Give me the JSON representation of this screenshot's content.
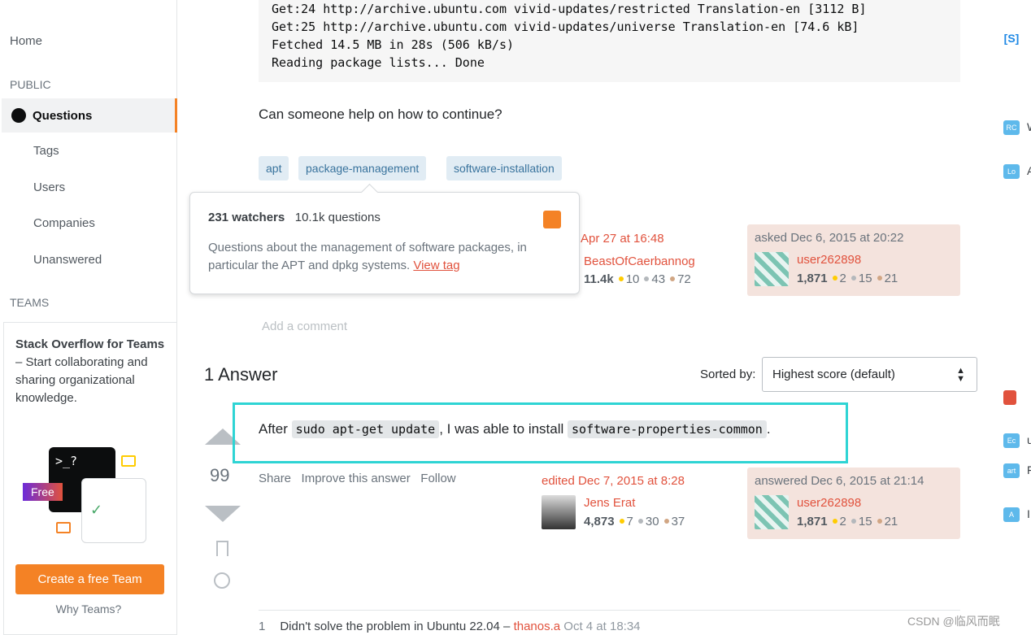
{
  "left": {
    "home": "Home",
    "public": "PUBLIC",
    "questions": "Questions",
    "tags": "Tags",
    "users": "Users",
    "companies": "Companies",
    "unanswered": "Unanswered",
    "teams": "TEAMS",
    "teams_title": "Stack Overflow for Teams",
    "teams_dash": " – Start collaborating and sharing organizational knowledge.",
    "free": "Free",
    "prompt": ">_?",
    "create": "Create a free Team",
    "why": "Why Teams?"
  },
  "code": "Get:24 http://archive.ubuntu.com vivid-updates/restricted Translation-en [3112 B]\nGet:25 http://archive.ubuntu.com vivid-updates/universe Translation-en [74.6 kB]\nFetched 14.5 MB in 28s (506 kB/s)\nReading package lists... Done",
  "question_end": "Can someone help on how to continue?",
  "tags": [
    "apt",
    "package-management",
    "software-installation"
  ],
  "popover": {
    "watchers": "231 watchers",
    "questions": "10.1k questions",
    "desc": "Questions about the management of software packages, in particular the APT and dpkg systems.",
    "view": "View tag",
    "rss_icon": "rss-icon"
  },
  "q_editor": {
    "when": "Apr 27 at 16:48",
    "name": "BeastOfCaerbannog",
    "rep": "11.4k",
    "gold": "10",
    "silver": "43",
    "bronze": "72"
  },
  "q_owner": {
    "when": "asked Dec 6, 2015 at 20:22",
    "name": "user262898",
    "rep": "1,871",
    "gold": "2",
    "silver": "15",
    "bronze": "21"
  },
  "add_comment": "Add a comment",
  "answers_header": "1 Answer",
  "sorted_by": "Sorted by:",
  "sort_value": "Highest score (default)",
  "answer": {
    "score": "99",
    "pre": "After ",
    "code1": "sudo apt-get update",
    "mid": ", I was able to install ",
    "code2": "software-properties-common",
    "post": ".",
    "share": "Share",
    "improve": "Improve this answer",
    "follow": "Follow"
  },
  "a_editor": {
    "when": "edited Dec 7, 2015 at 8:28",
    "name": "Jens Erat",
    "rep": "4,873",
    "gold": "7",
    "silver": "30",
    "bronze": "37"
  },
  "a_owner": {
    "when": "answered Dec 6, 2015 at 21:14",
    "name": "user262898",
    "rep": "1,871",
    "gold": "2",
    "silver": "15",
    "bronze": "21"
  },
  "comment": {
    "score": "1",
    "text": "Didn't solve the problem in Ubuntu 22.04 – ",
    "user": "thanos.a",
    "when": "Oct 4 at 18:34"
  },
  "right": {
    "items": [
      {
        "label": "RC",
        "color": "#5eb9eb",
        "t": "W"
      },
      {
        "label": "Lo",
        "color": "#5eb9eb",
        "t": "A"
      },
      {
        "label": "Ec",
        "color": "#5eb9eb",
        "t": "u"
      },
      {
        "label": "art",
        "color": "#5eb9eb",
        "t": "F"
      },
      {
        "label": "A",
        "color": "#5eb9eb",
        "t": "I"
      }
    ]
  },
  "watermark": "CSDN @临风而眠",
  "colors": {
    "accent": "#f48225",
    "link": "#e1523d",
    "highlight": "#2ed4d4"
  }
}
